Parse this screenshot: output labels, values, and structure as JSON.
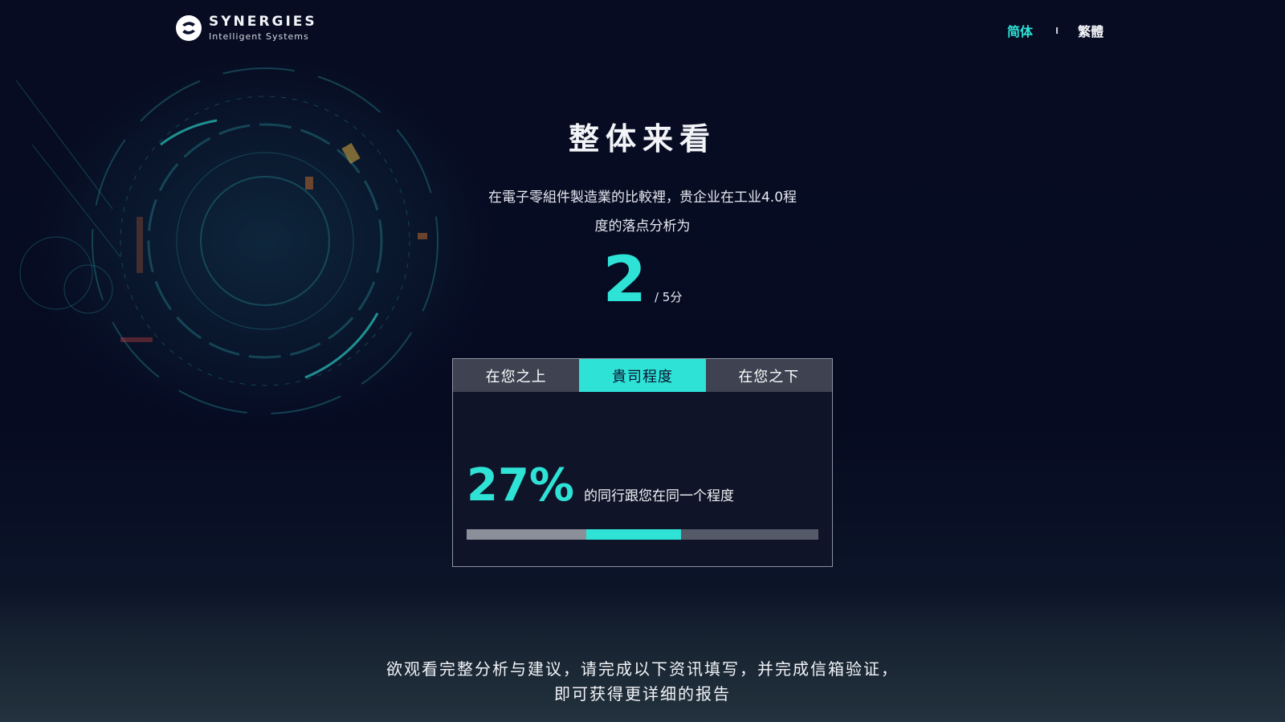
{
  "brand": {
    "name": "SYNERGIES",
    "tagline": "Intelligent Systems"
  },
  "language_switch": {
    "simplified": "简体",
    "separator": "I",
    "traditional": "繁體",
    "active": "simplified"
  },
  "main": {
    "title": "整体来看",
    "description_line1": "在電子零組件製造業的比較裡，贵企业在工业4.0程",
    "description_line2": "度的落点分析为",
    "score": "2",
    "score_total": "/ 5分"
  },
  "comparison": {
    "tabs": [
      {
        "label": "在您之上",
        "active": false
      },
      {
        "label": "貴司程度",
        "active": true
      },
      {
        "label": "在您之下",
        "active": false
      }
    ],
    "percent": "27%",
    "percent_text": "的同行跟您在同一个程度",
    "bar": {
      "above_fraction": 0.34,
      "same_fraction": 0.27,
      "below_fraction": 0.39
    }
  },
  "cta": {
    "line1": "欲观看完整分析与建议，请完成以下资讯填写，并完成信箱验证，",
    "line2": "即可获得更详细的报告"
  },
  "colors": {
    "accent": "#2fe2d6",
    "background": "#050a1f",
    "tab_inactive": "#3e4251",
    "bar_above": "#8b8f99",
    "bar_below": "#555a68"
  }
}
